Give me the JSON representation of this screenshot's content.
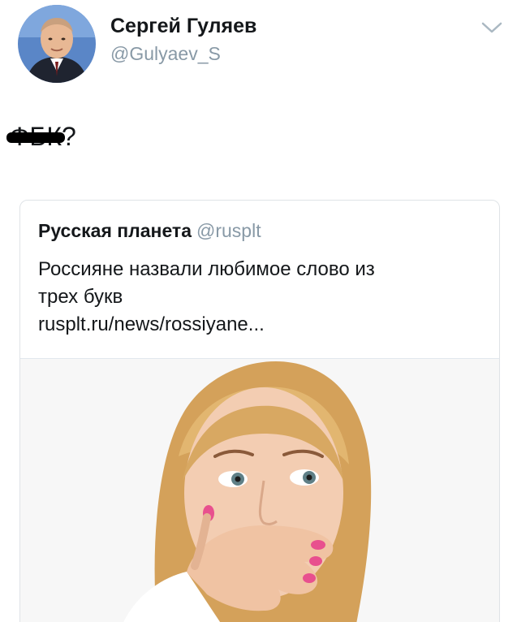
{
  "author": {
    "name": "Сергей Гуляев",
    "handle": "@Gulyaev_S",
    "avatar_icon": "person-avatar"
  },
  "tweet": {
    "struck_text": "ФБК",
    "text_after": "?"
  },
  "quoted_tweet": {
    "name": "Русская планета",
    "handle": "@rusplt",
    "text_line1": "Россияне назвали любимое слово из",
    "text_line2": "трех букв",
    "link": "rusplt.ru/news/rossiyane..."
  },
  "icons": {
    "menu": "chevron-down-icon"
  },
  "colors": {
    "name_text": "#14171a",
    "secondary_text": "#8899a6",
    "card_border": "#dfe3e7"
  }
}
